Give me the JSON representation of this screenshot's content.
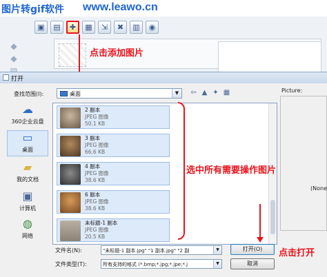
{
  "banner": {
    "title": "图片转gif软件",
    "url": "www.leawo.cn"
  },
  "toolbar": {
    "buttons": [
      {
        "icon": "save-icon",
        "glyph": "▣"
      },
      {
        "icon": "save-as-icon",
        "glyph": "▤"
      },
      {
        "icon": "add-image-icon",
        "glyph": "✚"
      },
      {
        "icon": "insert-frame-icon",
        "glyph": "▦"
      },
      {
        "icon": "import-icon",
        "glyph": "⇲"
      },
      {
        "icon": "delete-frame-icon",
        "glyph": "✖"
      },
      {
        "icon": "film-icon",
        "glyph": "▥"
      },
      {
        "icon": "camera-icon",
        "glyph": "◉"
      }
    ]
  },
  "annotations": {
    "add_image": "点击添加图片",
    "select_all": "选中所有需要操作图片",
    "click_open": "点击打开"
  },
  "dialog": {
    "title": "打开",
    "look_in_label": "查找范围(I):",
    "look_in_value": "桌面",
    "places": [
      {
        "label": "360企业云盘",
        "icon": "cloud-icon",
        "glyph": "☁"
      },
      {
        "label": "桌面",
        "icon": "desktop-icon",
        "glyph": "▭"
      },
      {
        "label": "我的文档",
        "icon": "documents-folder-icon",
        "glyph": "▰"
      },
      {
        "label": "计算机",
        "icon": "computer-icon",
        "glyph": "▣"
      },
      {
        "label": "网络",
        "icon": "network-icon",
        "glyph": "◍"
      }
    ],
    "files": [
      {
        "name": "2 副本",
        "type": "JPEG 图像",
        "size": "50.1 KB",
        "thumb": "dog-icon"
      },
      {
        "name": "3 副本",
        "type": "JPEG 图像",
        "size": "66.6 KB",
        "thumb": "dog-icon"
      },
      {
        "name": "4 副本",
        "type": "JPEG 图像",
        "size": "38.6 KB",
        "thumb": "dog-icon"
      },
      {
        "name": "6 副本",
        "type": "JPEG 图像",
        "size": "38.6 KB",
        "thumb": "dog-icon"
      },
      {
        "name": "未标题-1 副本",
        "type": "JPEG 图像",
        "size": "20.5 KB",
        "thumb": "image-icon"
      }
    ],
    "filename_label": "文件名(N):",
    "filename_value": "\"未标题-1 副本.jpg\" \"1 副本.jpg\" \"2 副",
    "filetype_label": "文件类型(T):",
    "filetype_value": "所有支持的格式 (*.bmp;*.jpg;*.jpe;*.j",
    "open_button": "打开(O)",
    "cancel_button": "取消",
    "picture_label": "Picture:",
    "preview_none": "(None"
  },
  "colors": {
    "annotation": "#e8141c",
    "banner": "#1f66d1",
    "selection": "#ddeafa"
  }
}
